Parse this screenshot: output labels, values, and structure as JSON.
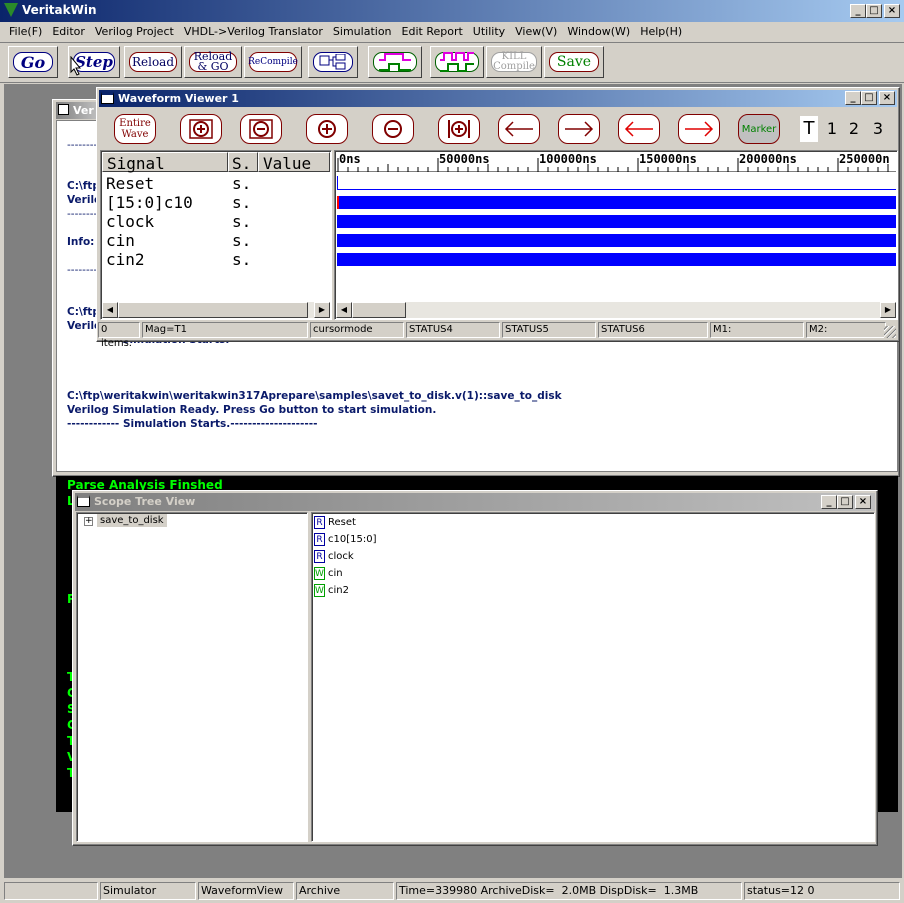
{
  "app": {
    "title": "VeritakWin"
  },
  "menu": [
    "File(F)",
    "Editor",
    "Verilog Project",
    "VHDL->Verilog Translator",
    "Simulation",
    "Edit Report",
    "Utility",
    "View(V)",
    "Window(W)",
    "Help(H)"
  ],
  "toolbar": {
    "go": "Go",
    "step": "Step",
    "reload": "Reload",
    "reload_go_1": "Reload",
    "reload_go_2": "& GO",
    "recompile": "ReCompile",
    "kill_1": "KILL",
    "kill_2": "Compile",
    "save": "Save"
  },
  "waveform": {
    "title": "Waveform Viewer 1",
    "entire_1": "Entire",
    "entire_2": "Wave",
    "marker": "Marker",
    "tabs": [
      "T",
      "1",
      "2",
      "3"
    ],
    "headers": {
      "signal": "Signal",
      "s": "S.",
      "value": "Value"
    },
    "signals": [
      {
        "name": "Reset",
        "s": "s."
      },
      {
        "name": "[15:0]c10",
        "s": "s."
      },
      {
        "name": "clock",
        "s": "s."
      },
      {
        "name": "cin",
        "s": "s."
      },
      {
        "name": "cin2",
        "s": "s."
      }
    ],
    "time_labels": [
      "0ns",
      "50000ns",
      "100000ns",
      "150000ns",
      "200000ns",
      "250000n"
    ],
    "status": [
      "0 items.",
      "Mag=T1",
      "cursormode",
      "STATUS4",
      "STATUS5",
      "STATUS6",
      "M1:",
      "M2:"
    ]
  },
  "console": {
    "title_partial": "Ver",
    "left_fragments": [
      "C:\\ftp",
      "Verilo",
      "Info: S",
      "C:\\ftp",
      "Verilo"
    ],
    "partial_line": "Simulation Starts.",
    "lines": [
      "C:\\ftp\\weritakwin\\weritakwin317Aprepare\\samples\\savet_to_disk.v(1)::save_to_disk",
      "Verilog Simulation Ready. Press Go button to start simulation.",
      "------------ Simulation Starts.--------------------"
    ],
    "dashes": "--------"
  },
  "output": {
    "parse_line": "Parse Analysis Finshed",
    "fragments": [
      "L",
      "P",
      "T",
      "C",
      "S",
      "C",
      "T",
      "V",
      "T"
    ]
  },
  "scope": {
    "title": "Scope Tree View",
    "tree_root": "save_to_disk",
    "expander": "+",
    "items": [
      {
        "icon": "R",
        "label": "Reset"
      },
      {
        "icon": "R",
        "label": "c10[15:0]"
      },
      {
        "icon": "R",
        "label": "clock"
      },
      {
        "icon": "W",
        "label": "cin"
      },
      {
        "icon": "W",
        "label": "cin2"
      }
    ]
  },
  "statusbar": [
    "",
    "Simulator",
    "WaveformView",
    "Archive",
    "Time=339980 ArchiveDisk=  2.0MB DispDisk=  1.3MB",
    "status=12 0"
  ]
}
